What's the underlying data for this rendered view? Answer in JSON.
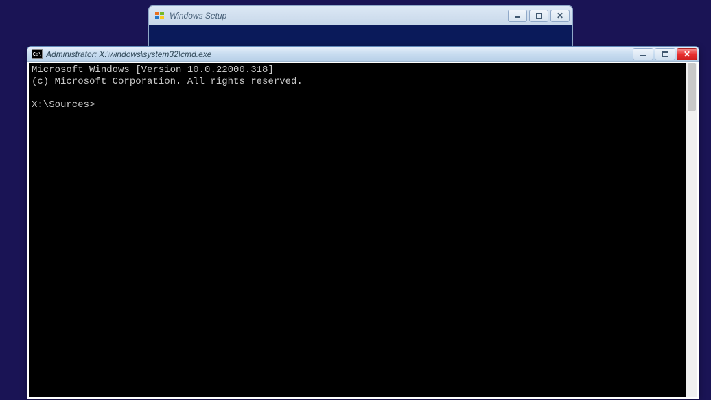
{
  "setup_window": {
    "title": "Windows Setup"
  },
  "cmd_window": {
    "title": "Administrator: X:\\windows\\system32\\cmd.exe",
    "icon_text": "C:\\",
    "content": {
      "line1": "Microsoft Windows [Version 10.0.22000.318]",
      "line2": "(c) Microsoft Corporation. All rights reserved.",
      "line3": "",
      "prompt": "X:\\Sources>"
    }
  }
}
